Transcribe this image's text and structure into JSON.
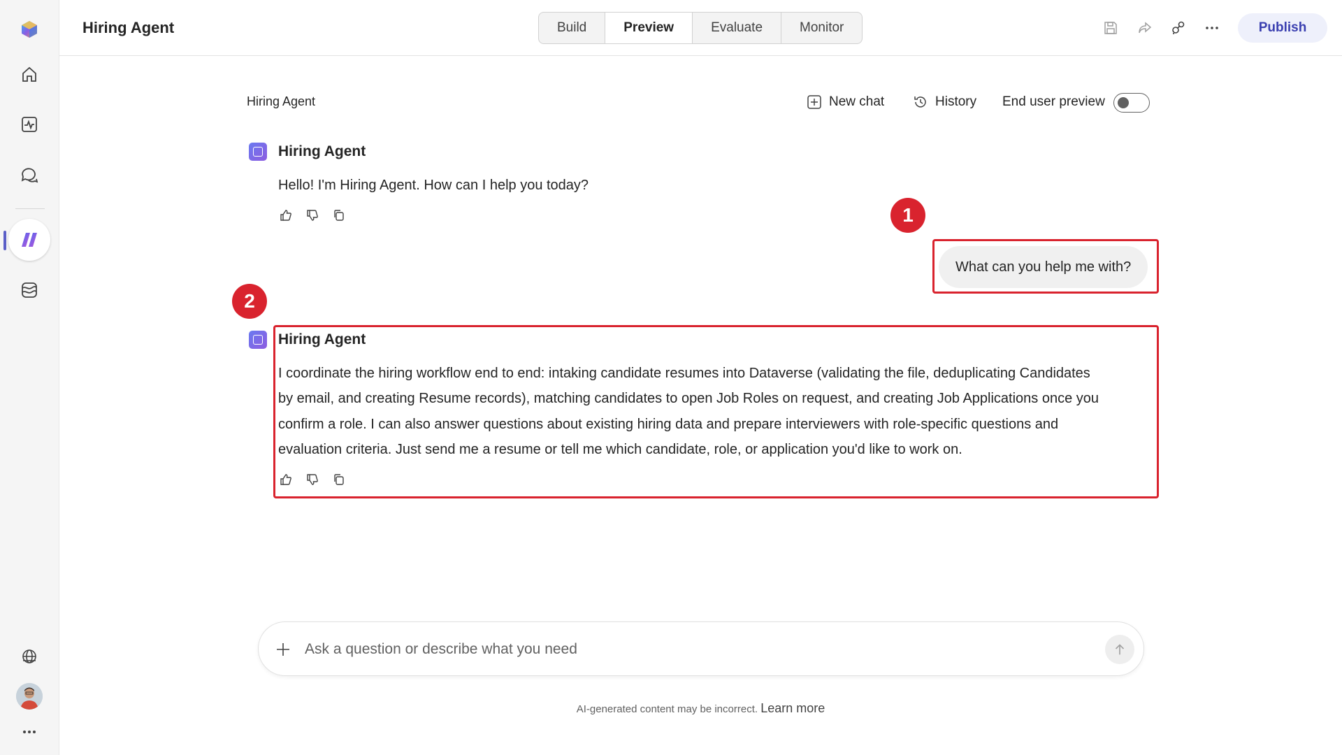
{
  "topbar": {
    "app_title": "Hiring Agent",
    "tabs": [
      {
        "label": "Build",
        "active": false
      },
      {
        "label": "Preview",
        "active": true
      },
      {
        "label": "Evaluate",
        "active": false
      },
      {
        "label": "Monitor",
        "active": false
      }
    ],
    "publish_label": "Publish",
    "icons": [
      "save-icon",
      "share-icon",
      "connections-icon",
      "more-icon"
    ]
  },
  "rail": {
    "items": [
      "copilot-logo-icon",
      "home-icon",
      "activity-icon",
      "chat-icon",
      "agents-icon",
      "library-icon",
      "globe-icon",
      "avatar",
      "more-icon"
    ],
    "accent": "#5b5fc7"
  },
  "chat": {
    "title": "Hiring Agent",
    "new_chat_label": "New chat",
    "history_label": "History",
    "end_user_preview_label": "End user preview",
    "end_user_preview_on": false,
    "messages": [
      {
        "role": "agent",
        "name": "Hiring Agent",
        "text": "Hello! I'm Hiring Agent. How can I help you today?"
      },
      {
        "role": "user",
        "text": "What can you help me with?"
      },
      {
        "role": "agent",
        "name": "Hiring Agent",
        "lines": [
          "I coordinate the hiring workflow end to end: intaking candidate resumes into Dataverse (validating the file, deduplicating Candidates",
          "by email, and creating Resume records), matching candidates to open Job Roles on request, and creating Job Applications once you",
          "confirm a role. I can also answer questions about existing hiring data and prepare interviewers with role-specific questions and",
          "evaluation criteria. Just send me a resume or tell me which candidate, role, or application you'd like to work on."
        ]
      }
    ]
  },
  "annotations": {
    "one": "1",
    "two": "2",
    "color": "#d9232e"
  },
  "composer": {
    "placeholder": "Ask a question or describe what you need"
  },
  "footer": {
    "disclaimer": "AI-generated content may be incorrect.",
    "learn_more": "Learn more"
  }
}
